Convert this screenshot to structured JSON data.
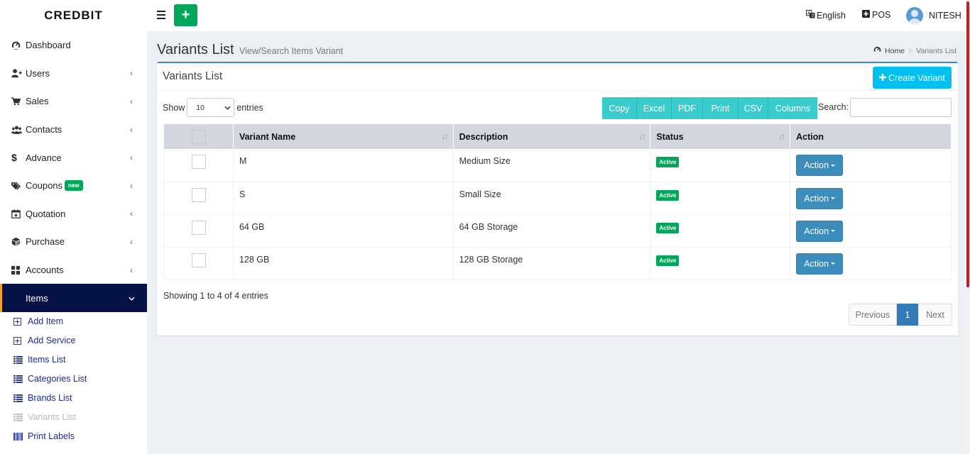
{
  "brand": "CREDBIT",
  "header": {
    "language": "English",
    "pos": "POS",
    "user": "NITESH"
  },
  "sidebar": {
    "items": [
      {
        "label": "Dashboard",
        "icon": "dashboard-icon",
        "has_submenu": false
      },
      {
        "label": "Users",
        "icon": "user-plus-icon",
        "has_submenu": true
      },
      {
        "label": "Sales",
        "icon": "cart-icon",
        "has_submenu": true
      },
      {
        "label": "Contacts",
        "icon": "users-icon",
        "has_submenu": true
      },
      {
        "label": "Advance",
        "icon": "dollar-icon",
        "has_submenu": true
      },
      {
        "label": "Coupons",
        "icon": "tags-icon",
        "has_submenu": true,
        "badge": "new"
      },
      {
        "label": "Quotation",
        "icon": "calendar-icon",
        "has_submenu": true
      },
      {
        "label": "Purchase",
        "icon": "cube-icon",
        "has_submenu": true
      },
      {
        "label": "Accounts",
        "icon": "grid-icon",
        "has_submenu": true
      },
      {
        "label": "Items",
        "icon": "none",
        "has_submenu": true,
        "active": true
      }
    ],
    "sub_items": [
      {
        "label": "Add Item",
        "icon": "plus-square-icon"
      },
      {
        "label": "Add Service",
        "icon": "plus-square-icon"
      },
      {
        "label": "Items List",
        "icon": "list-icon"
      },
      {
        "label": "Categories List",
        "icon": "list-icon"
      },
      {
        "label": "Brands List",
        "icon": "list-icon"
      },
      {
        "label": "Variants List",
        "icon": "list-icon",
        "current": true
      },
      {
        "label": "Print Labels",
        "icon": "barcode-icon"
      }
    ]
  },
  "page": {
    "title": "Variants List",
    "subtitle": "View/Search Items Variant",
    "breadcrumb": [
      "Home",
      "Variants List"
    ]
  },
  "box": {
    "title": "Variants List",
    "create_label": "Create Variant"
  },
  "controls": {
    "show_label": "Show",
    "entries_value": "10",
    "entries_label": "entries",
    "export_buttons": [
      "Copy",
      "Excel",
      "PDF",
      "Print",
      "CSV",
      "Columns"
    ],
    "search_label": "Search:",
    "search_value": ""
  },
  "table": {
    "columns": [
      "Variant Name",
      "Description",
      "Status",
      "Action"
    ],
    "rows": [
      {
        "name": "M",
        "description": "Medium Size",
        "status": "Active",
        "action": "Action"
      },
      {
        "name": "S",
        "description": "Small Size",
        "status": "Active",
        "action": "Action"
      },
      {
        "name": "64 GB",
        "description": "64 GB Storage",
        "status": "Active",
        "action": "Action"
      },
      {
        "name": "128 GB",
        "description": "128 GB Storage",
        "status": "Active",
        "action": "Action"
      }
    ]
  },
  "footer": {
    "info": "Showing 1 to 4 of 4 entries",
    "previous": "Previous",
    "page": "1",
    "next": "Next"
  },
  "colors": {
    "sidebar_active": "#061146",
    "accent_green": "#00a65a",
    "primary": "#3c8dbc",
    "info": "#00c0ef",
    "export": "#39cccc"
  }
}
